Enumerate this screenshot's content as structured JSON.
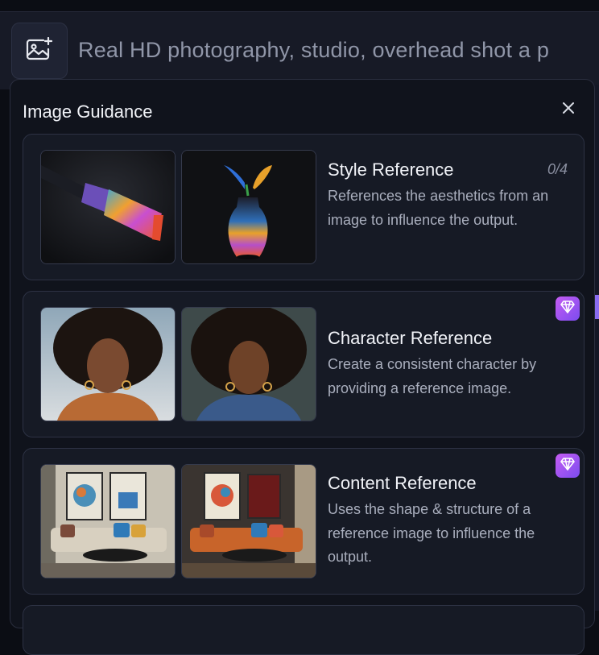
{
  "prompt": {
    "text": "Real HD photography, studio, overhead shot a p"
  },
  "panel": {
    "title": "Image Guidance",
    "close_icon": "close-icon"
  },
  "cards": [
    {
      "title": "Style Reference",
      "description": "References the aesthetics from an image to influence the output.",
      "count": "0/4",
      "thumbnails": [
        "paintbrush",
        "vase-with-flowers"
      ]
    },
    {
      "title": "Character Reference",
      "description": "Create a consistent character by providing a reference image.",
      "badge_icon": "diamond-icon",
      "thumbnails": [
        "portrait-woman-1",
        "portrait-woman-2"
      ]
    },
    {
      "title": "Content Reference",
      "description": "Uses the shape & structure of a reference image to influence the output.",
      "badge_icon": "diamond-icon",
      "thumbnails": [
        "living-room-1",
        "living-room-2"
      ]
    }
  ],
  "colors": {
    "background": "#0b0d14",
    "panel": "#10131c",
    "card": "#161a25",
    "premium_badge": "#b05cf2"
  }
}
